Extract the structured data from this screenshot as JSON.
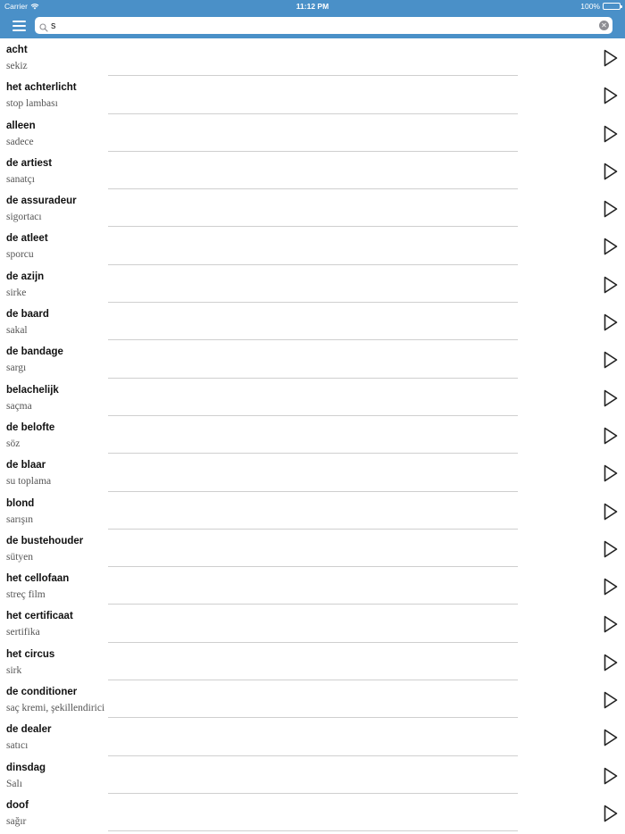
{
  "status_bar": {
    "carrier": "Carrier",
    "time": "11:12 PM",
    "battery": "100%",
    "battery_level": 1.0
  },
  "search": {
    "value": "s",
    "placeholder": ""
  },
  "icons": {
    "menu": "hamburger-menu-icon",
    "search": "magnifier-icon",
    "clear": "clear-circle-icon",
    "play": "play-triangle-icon",
    "wifi": "wifi-icon",
    "battery": "battery-icon"
  },
  "colors": {
    "accent": "#4a90c8",
    "divider": "#cfcfcf",
    "term": "#111111",
    "translation": "#555555"
  },
  "words": [
    {
      "term": "acht",
      "translation": "sekiz"
    },
    {
      "term": "het achterlicht",
      "translation": "stop lambası"
    },
    {
      "term": "alleen",
      "translation": "sadece"
    },
    {
      "term": "de artiest",
      "translation": "sanatçı"
    },
    {
      "term": "de assuradeur",
      "translation": "sigortacı"
    },
    {
      "term": "de atleet",
      "translation": "sporcu"
    },
    {
      "term": "de azijn",
      "translation": "sirke"
    },
    {
      "term": "de baard",
      "translation": "sakal"
    },
    {
      "term": "de bandage",
      "translation": "sargı"
    },
    {
      "term": "belachelijk",
      "translation": "saçma"
    },
    {
      "term": "de belofte",
      "translation": "söz"
    },
    {
      "term": "de blaar",
      "translation": "su toplama"
    },
    {
      "term": "blond",
      "translation": "sarışın"
    },
    {
      "term": "de bustehouder",
      "translation": "sütyen"
    },
    {
      "term": "het cellofaan",
      "translation": "streç film"
    },
    {
      "term": "het certificaat",
      "translation": "sertifika"
    },
    {
      "term": "het circus",
      "translation": "sirk"
    },
    {
      "term": "de conditioner",
      "translation": "saç kremi, şekillendirici"
    },
    {
      "term": "de dealer",
      "translation": "satıcı"
    },
    {
      "term": "dinsdag",
      "translation": "Salı"
    },
    {
      "term": "doof",
      "translation": "sağır"
    }
  ]
}
